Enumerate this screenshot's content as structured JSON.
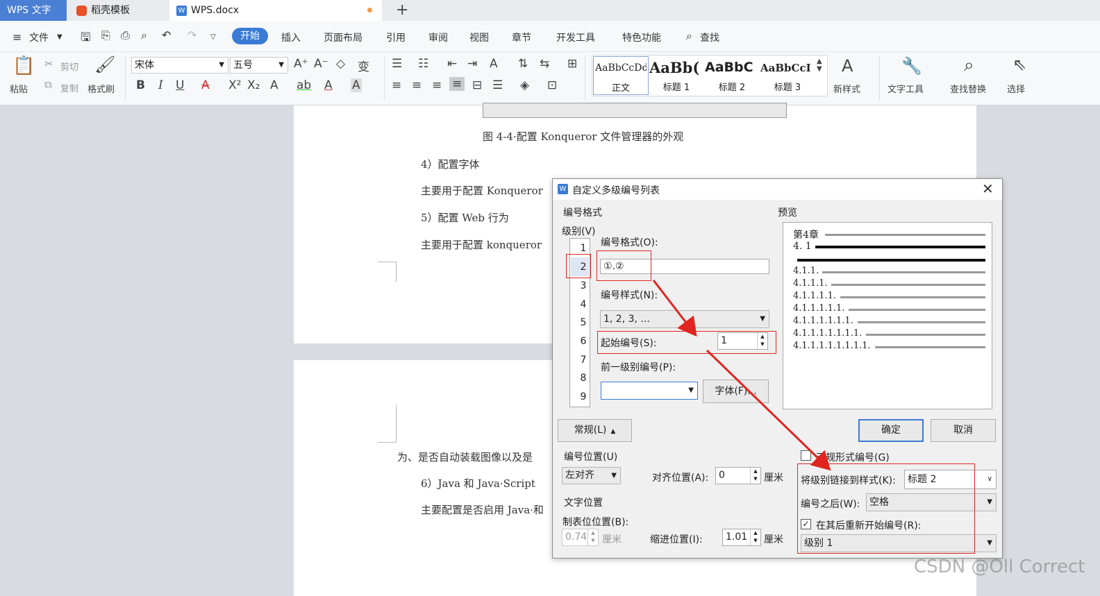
{
  "tabs": [
    {
      "label": "WPS 文字"
    },
    {
      "label": "稻壳模板"
    },
    {
      "label": "WPS.docx"
    }
  ],
  "tab_add": "+",
  "menu": {
    "file": "文件",
    "items": [
      "开始",
      "插入",
      "页面布局",
      "引用",
      "审阅",
      "视图",
      "章节",
      "开发工具",
      "特色功能",
      "查找"
    ]
  },
  "ribbon": {
    "paste": "粘贴",
    "cut": "剪切",
    "copy": "复制",
    "format_painter": "格式刷",
    "font_name": "宋体",
    "font_size": "五号",
    "styles": [
      {
        "preview": "AaBbCcDd",
        "name": "正文"
      },
      {
        "preview": "AaBb(",
        "name": "标题 1"
      },
      {
        "preview": "AaBbC",
        "name": "标题 2"
      },
      {
        "preview": "AaBbCcI",
        "name": "标题 3"
      }
    ],
    "new_style": "新样式",
    "text_tools": "文字工具",
    "find_replace": "查找替换",
    "select": "选择"
  },
  "document": {
    "caption": "图 4-4·配置 Konqueror 文件管理器的外观",
    "items": [
      "4）配置字体",
      "主要用于配置 Konqueror",
      "5）配置 Web 行为",
      "主要用于配置 konqueror",
      "为、是否自动装载图像以及是",
      "6）Java 和 Java·Script",
      "主要配置是否启用 Java·和"
    ]
  },
  "dialog": {
    "title": "自定义多级编号列表",
    "section_format": "编号格式",
    "level_label": "级别(V)",
    "levels": [
      "1",
      "2",
      "3",
      "4",
      "5",
      "6",
      "7",
      "8",
      "9"
    ],
    "selected_level": "2",
    "number_format_label": "编号格式(O):",
    "number_format_value": "①.②",
    "number_style_label": "编号样式(N):",
    "number_style_value": "1, 2, 3, ...",
    "start_label": "起始编号(S):",
    "start_value": "1",
    "prev_level_label": "前一级别编号(P):",
    "font_button": "字体(F)...",
    "preview_label": "预览",
    "preview_lines": [
      "第4章",
      "4. 1",
      "4.1.1.",
      "4.1.1.1.",
      "4.1.1.1.1.",
      "4.1.1.1.1.1.",
      "4.1.1.1.1.1.1.",
      "4.1.1.1.1.1.1.1.",
      "4.1.1.1.1.1.1.1.1."
    ],
    "ok": "确定",
    "cancel": "取消",
    "general_button": "常规(L)",
    "position_label": "编号位置(U)",
    "align_value": "左对齐",
    "align_pos_label": "对齐位置(A):",
    "align_pos_value": "0",
    "unit": "厘米",
    "text_pos_label": "文字位置",
    "tab_pos_label": "制表位位置(B):",
    "tab_pos_value": "0.74",
    "indent_label": "缩进位置(I):",
    "indent_value": "1.01",
    "legal_label": "正规形式编号(G)",
    "link_label": "将级别链接到样式(K):",
    "link_value": "标题 2",
    "after_label": "编号之后(W):",
    "after_value": "空格",
    "restart_label": "在其后重新开始编号(R):",
    "restart_value": "级别 1"
  },
  "watermark": "CSDN @Oll Correct",
  "colors": {
    "accent": "#3a7bd5",
    "annotation": "#e0241f"
  }
}
